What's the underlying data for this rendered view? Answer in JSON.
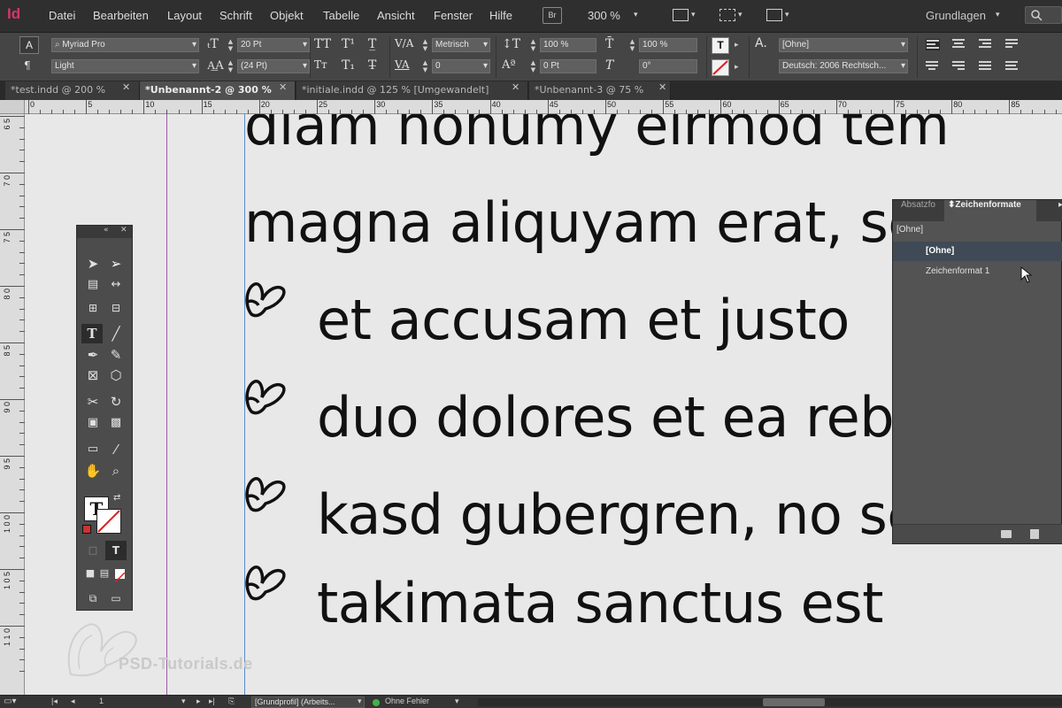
{
  "app": {
    "logo": "Id",
    "brand_color": "#d6346f"
  },
  "menu": [
    "Datei",
    "Bearbeiten",
    "Layout",
    "Schrift",
    "Objekt",
    "Tabelle",
    "Ansicht",
    "Fenster",
    "Hilfe"
  ],
  "appbar": {
    "bridge_label": "Br",
    "zoom": "300 %",
    "workspace": "Grundlagen"
  },
  "control_panel": {
    "font_family": "Myriad Pro",
    "font_style": "Light",
    "font_size": "20 Pt",
    "leading": "(24 Pt)",
    "kerning": "Metrisch",
    "tracking": "0",
    "vertical_scale": "100 %",
    "horizontal_scale": "100 %",
    "baseline_shift": "0 Pt",
    "skew": "0°",
    "char_style": "[Ohne]",
    "language": "Deutsch: 2006 Rechtsch..."
  },
  "tabs": [
    {
      "label": "*test.indd @ 200 %",
      "active": false
    },
    {
      "label": "*Unbenannt-2 @ 300 %",
      "active": true
    },
    {
      "label": "*initiale.indd @ 125 % [Umgewandelt]",
      "active": false
    },
    {
      "label": "*Unbenannt-3 @ 75 %",
      "active": false
    }
  ],
  "ruler": {
    "h_marks": [
      "0",
      "5",
      "10",
      "15",
      "20",
      "25",
      "30",
      "35",
      "40",
      "45",
      "50",
      "55",
      "60",
      "65",
      "70",
      "75",
      "80",
      "85"
    ],
    "v_marks": [
      "6 5",
      "7 0",
      "7 5",
      "8 0",
      "8 5",
      "9 0",
      "9 5",
      "1 0 0",
      "1 0 5",
      "1 1 0"
    ]
  },
  "document": {
    "lines": [
      {
        "text": "diam nonumy eirmod tem",
        "bullet": false
      },
      {
        "text": "magna aliquyam erat, sed",
        "bullet": false
      },
      {
        "text": "et accusam et justo",
        "bullet": true
      },
      {
        "text": "duo dolores et ea rebum",
        "bullet": true
      },
      {
        "text": "kasd gubergren, no sea",
        "bullet": true
      },
      {
        "text": "takimata sanctus est",
        "bullet": true
      }
    ]
  },
  "char_styles_panel": {
    "tab_inactive": "Absatzfo",
    "tab_active": "Zeichenformate",
    "current": "[Ohne]",
    "items": [
      {
        "label": "[Ohne]",
        "selected": true
      },
      {
        "label": "Zeichenformat 1",
        "selected": false
      }
    ]
  },
  "status": {
    "page": "1",
    "profile": "[Grundprofil] (Arbeits...",
    "preflight": "Ohne Fehler",
    "preflight_color": "#3fb24a"
  },
  "watermark": "PSD-Tutorials.de"
}
